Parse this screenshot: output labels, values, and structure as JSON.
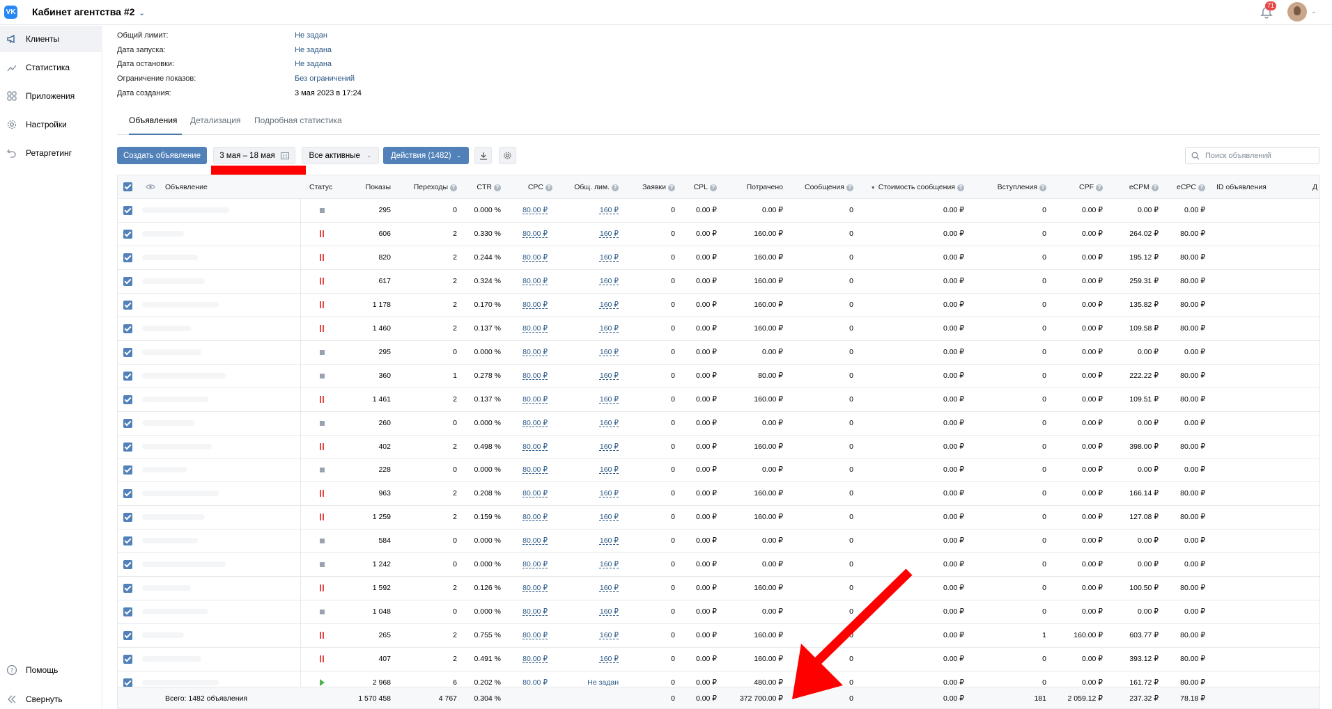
{
  "topbar": {
    "logo": "VK",
    "cabinet_title": "Кабинет агентства #2",
    "notifications_count": "71"
  },
  "sidebar": {
    "items": [
      {
        "label": "Клиенты",
        "icon": "megaphone-icon",
        "active": true
      },
      {
        "label": "Статистика",
        "icon": "chart-icon"
      },
      {
        "label": "Приложения",
        "icon": "apps-icon"
      },
      {
        "label": "Настройки",
        "icon": "gear-icon"
      },
      {
        "label": "Ретаргетинг",
        "icon": "retarget-icon"
      }
    ],
    "help": "Помощь",
    "collapse": "Свернуть"
  },
  "info": [
    {
      "label": "Общий лимит:",
      "value": "Не задан",
      "link": true
    },
    {
      "label": "Дата запуска:",
      "value": "Не задана",
      "link": true
    },
    {
      "label": "Дата остановки:",
      "value": "Не задана",
      "link": true
    },
    {
      "label": "Ограничение показов:",
      "value": "Без ограничений",
      "link": true
    },
    {
      "label": "Дата создания:",
      "value": "3 мая 2023 в 17:24",
      "link": false
    }
  ],
  "tabs": [
    "Объявления",
    "Детализация",
    "Подробная статистика"
  ],
  "toolbar": {
    "create": "Создать объявление",
    "date_range": "3 мая – 18 мая",
    "filter": "Все активные",
    "actions": "Действия (1482)",
    "search_placeholder": "Поиск объявлений"
  },
  "columns": [
    "Объявление",
    "Статус",
    "Показы",
    "Переходы",
    "CTR",
    "CPC",
    "Общ. лим.",
    "Заявки",
    "CPL",
    "Потрачено",
    "Сообщения",
    "Стоимость сообщения",
    "Вступления",
    "CPF",
    "eCPM",
    "eCPC",
    "ID объявления",
    "Д"
  ],
  "rows": [
    {
      "status": "stop",
      "shows": "295",
      "clicks": "0",
      "ctr": "0.000 %",
      "cpc": "80.00 ₽",
      "limit": "160 ₽",
      "leads": "0",
      "cpl": "0.00 ₽",
      "spent": "0.00 ₽",
      "msgs": "0",
      "msgcost": "0.00 ₽",
      "joins": "0",
      "cpf": "0.00 ₽",
      "ecpm": "0.00 ₽",
      "ecpc": "0.00 ₽"
    },
    {
      "status": "pause",
      "shows": "606",
      "clicks": "2",
      "ctr": "0.330 %",
      "cpc": "80.00 ₽",
      "limit": "160 ₽",
      "leads": "0",
      "cpl": "0.00 ₽",
      "spent": "160.00 ₽",
      "msgs": "0",
      "msgcost": "0.00 ₽",
      "joins": "0",
      "cpf": "0.00 ₽",
      "ecpm": "264.02 ₽",
      "ecpc": "80.00 ₽"
    },
    {
      "status": "pause",
      "shows": "820",
      "clicks": "2",
      "ctr": "0.244 %",
      "cpc": "80.00 ₽",
      "limit": "160 ₽",
      "leads": "0",
      "cpl": "0.00 ₽",
      "spent": "160.00 ₽",
      "msgs": "0",
      "msgcost": "0.00 ₽",
      "joins": "0",
      "cpf": "0.00 ₽",
      "ecpm": "195.12 ₽",
      "ecpc": "80.00 ₽"
    },
    {
      "status": "pause",
      "shows": "617",
      "clicks": "2",
      "ctr": "0.324 %",
      "cpc": "80.00 ₽",
      "limit": "160 ₽",
      "leads": "0",
      "cpl": "0.00 ₽",
      "spent": "160.00 ₽",
      "msgs": "0",
      "msgcost": "0.00 ₽",
      "joins": "0",
      "cpf": "0.00 ₽",
      "ecpm": "259.31 ₽",
      "ecpc": "80.00 ₽"
    },
    {
      "status": "pause",
      "shows": "1 178",
      "clicks": "2",
      "ctr": "0.170 %",
      "cpc": "80.00 ₽",
      "limit": "160 ₽",
      "leads": "0",
      "cpl": "0.00 ₽",
      "spent": "160.00 ₽",
      "msgs": "0",
      "msgcost": "0.00 ₽",
      "joins": "0",
      "cpf": "0.00 ₽",
      "ecpm": "135.82 ₽",
      "ecpc": "80.00 ₽"
    },
    {
      "status": "pause",
      "shows": "1 460",
      "clicks": "2",
      "ctr": "0.137 %",
      "cpc": "80.00 ₽",
      "limit": "160 ₽",
      "leads": "0",
      "cpl": "0.00 ₽",
      "spent": "160.00 ₽",
      "msgs": "0",
      "msgcost": "0.00 ₽",
      "joins": "0",
      "cpf": "0.00 ₽",
      "ecpm": "109.58 ₽",
      "ecpc": "80.00 ₽"
    },
    {
      "status": "stop",
      "shows": "295",
      "clicks": "0",
      "ctr": "0.000 %",
      "cpc": "80.00 ₽",
      "limit": "160 ₽",
      "leads": "0",
      "cpl": "0.00 ₽",
      "spent": "0.00 ₽",
      "msgs": "0",
      "msgcost": "0.00 ₽",
      "joins": "0",
      "cpf": "0.00 ₽",
      "ecpm": "0.00 ₽",
      "ecpc": "0.00 ₽"
    },
    {
      "status": "stop",
      "shows": "360",
      "clicks": "1",
      "ctr": "0.278 %",
      "cpc": "80.00 ₽",
      "limit": "160 ₽",
      "leads": "0",
      "cpl": "0.00 ₽",
      "spent": "80.00 ₽",
      "msgs": "0",
      "msgcost": "0.00 ₽",
      "joins": "0",
      "cpf": "0.00 ₽",
      "ecpm": "222.22 ₽",
      "ecpc": "80.00 ₽"
    },
    {
      "status": "pause",
      "shows": "1 461",
      "clicks": "2",
      "ctr": "0.137 %",
      "cpc": "80.00 ₽",
      "limit": "160 ₽",
      "leads": "0",
      "cpl": "0.00 ₽",
      "spent": "160.00 ₽",
      "msgs": "0",
      "msgcost": "0.00 ₽",
      "joins": "0",
      "cpf": "0.00 ₽",
      "ecpm": "109.51 ₽",
      "ecpc": "80.00 ₽"
    },
    {
      "status": "stop",
      "shows": "260",
      "clicks": "0",
      "ctr": "0.000 %",
      "cpc": "80.00 ₽",
      "limit": "160 ₽",
      "leads": "0",
      "cpl": "0.00 ₽",
      "spent": "0.00 ₽",
      "msgs": "0",
      "msgcost": "0.00 ₽",
      "joins": "0",
      "cpf": "0.00 ₽",
      "ecpm": "0.00 ₽",
      "ecpc": "0.00 ₽"
    },
    {
      "status": "pause",
      "shows": "402",
      "clicks": "2",
      "ctr": "0.498 %",
      "cpc": "80.00 ₽",
      "limit": "160 ₽",
      "leads": "0",
      "cpl": "0.00 ₽",
      "spent": "160.00 ₽",
      "msgs": "0",
      "msgcost": "0.00 ₽",
      "joins": "0",
      "cpf": "0.00 ₽",
      "ecpm": "398.00 ₽",
      "ecpc": "80.00 ₽"
    },
    {
      "status": "stop",
      "shows": "228",
      "clicks": "0",
      "ctr": "0.000 %",
      "cpc": "80.00 ₽",
      "limit": "160 ₽",
      "leads": "0",
      "cpl": "0.00 ₽",
      "spent": "0.00 ₽",
      "msgs": "0",
      "msgcost": "0.00 ₽",
      "joins": "0",
      "cpf": "0.00 ₽",
      "ecpm": "0.00 ₽",
      "ecpc": "0.00 ₽"
    },
    {
      "status": "pause",
      "shows": "963",
      "clicks": "2",
      "ctr": "0.208 %",
      "cpc": "80.00 ₽",
      "limit": "160 ₽",
      "leads": "0",
      "cpl": "0.00 ₽",
      "spent": "160.00 ₽",
      "msgs": "0",
      "msgcost": "0.00 ₽",
      "joins": "0",
      "cpf": "0.00 ₽",
      "ecpm": "166.14 ₽",
      "ecpc": "80.00 ₽"
    },
    {
      "status": "pause",
      "shows": "1 259",
      "clicks": "2",
      "ctr": "0.159 %",
      "cpc": "80.00 ₽",
      "limit": "160 ₽",
      "leads": "0",
      "cpl": "0.00 ₽",
      "spent": "160.00 ₽",
      "msgs": "0",
      "msgcost": "0.00 ₽",
      "joins": "0",
      "cpf": "0.00 ₽",
      "ecpm": "127.08 ₽",
      "ecpc": "80.00 ₽"
    },
    {
      "status": "stop",
      "shows": "584",
      "clicks": "0",
      "ctr": "0.000 %",
      "cpc": "80.00 ₽",
      "limit": "160 ₽",
      "leads": "0",
      "cpl": "0.00 ₽",
      "spent": "0.00 ₽",
      "msgs": "0",
      "msgcost": "0.00 ₽",
      "joins": "0",
      "cpf": "0.00 ₽",
      "ecpm": "0.00 ₽",
      "ecpc": "0.00 ₽"
    },
    {
      "status": "stop",
      "shows": "1 242",
      "clicks": "0",
      "ctr": "0.000 %",
      "cpc": "80.00 ₽",
      "limit": "160 ₽",
      "leads": "0",
      "cpl": "0.00 ₽",
      "spent": "0.00 ₽",
      "msgs": "0",
      "msgcost": "0.00 ₽",
      "joins": "0",
      "cpf": "0.00 ₽",
      "ecpm": "0.00 ₽",
      "ecpc": "0.00 ₽"
    },
    {
      "status": "pause",
      "shows": "1 592",
      "clicks": "2",
      "ctr": "0.126 %",
      "cpc": "80.00 ₽",
      "limit": "160 ₽",
      "leads": "0",
      "cpl": "0.00 ₽",
      "spent": "160.00 ₽",
      "msgs": "0",
      "msgcost": "0.00 ₽",
      "joins": "0",
      "cpf": "0.00 ₽",
      "ecpm": "100.50 ₽",
      "ecpc": "80.00 ₽"
    },
    {
      "status": "stop",
      "shows": "1 048",
      "clicks": "0",
      "ctr": "0.000 %",
      "cpc": "80.00 ₽",
      "limit": "160 ₽",
      "leads": "0",
      "cpl": "0.00 ₽",
      "spent": "0.00 ₽",
      "msgs": "0",
      "msgcost": "0.00 ₽",
      "joins": "0",
      "cpf": "0.00 ₽",
      "ecpm": "0.00 ₽",
      "ecpc": "0.00 ₽"
    },
    {
      "status": "pause",
      "shows": "265",
      "clicks": "2",
      "ctr": "0.755 %",
      "cpc": "80.00 ₽",
      "limit": "160 ₽",
      "leads": "0",
      "cpl": "0.00 ₽",
      "spent": "160.00 ₽",
      "msgs": "0",
      "msgcost": "0.00 ₽",
      "joins": "1",
      "cpf": "160.00 ₽",
      "ecpm": "603.77 ₽",
      "ecpc": "80.00 ₽"
    },
    {
      "status": "pause",
      "shows": "407",
      "clicks": "2",
      "ctr": "0.491 %",
      "cpc": "80.00 ₽",
      "limit": "160 ₽",
      "leads": "0",
      "cpl": "0.00 ₽",
      "spent": "160.00 ₽",
      "msgs": "0",
      "msgcost": "0.00 ₽",
      "joins": "0",
      "cpf": "0.00 ₽",
      "ecpm": "393.12 ₽",
      "ecpc": "80.00 ₽"
    },
    {
      "status": "play",
      "shows": "2 968",
      "clicks": "6",
      "ctr": "0.202 %",
      "cpc": "80.00 ₽",
      "limit": "Не задан",
      "leads": "0",
      "cpl": "0.00 ₽",
      "spent": "480.00 ₽",
      "msgs": "0",
      "msgcost": "0.00 ₽",
      "joins": "0",
      "cpf": "0.00 ₽",
      "ecpm": "161.72 ₽",
      "ecpc": "80.00 ₽"
    }
  ],
  "totals": {
    "label": "Всего: 1482 объявления",
    "shows": "1 570 458",
    "clicks": "4 767",
    "ctr": "0.304 %",
    "leads": "0",
    "cpl": "0.00 ₽",
    "spent": "372 700.00 ₽",
    "msgs": "0",
    "msgcost": "0.00 ₽",
    "joins": "181",
    "cpf": "2 059.12 ₽",
    "ecpm": "237.32 ₽",
    "ecpc": "78.18 ₽"
  },
  "colors": {
    "accent": "#5181b8",
    "link": "#2a5885",
    "annotation": "#ff0000"
  }
}
